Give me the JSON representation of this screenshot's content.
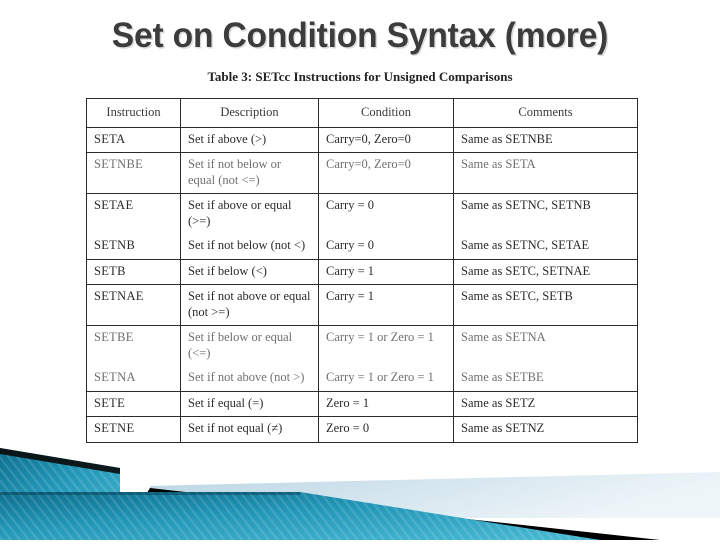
{
  "slide": {
    "title": "Set on Condition Syntax (more)",
    "caption": "Table 3: SETcc Instructions for Unsigned Comparisons"
  },
  "colors": {
    "title_text": "#3c3c3c",
    "title_shadow": "#bebebe",
    "table_border": "#2b2b2b",
    "ribbon_teal_dark": "#0f6d8c",
    "ribbon_teal_light": "#3fb2cf",
    "ribbon_pale_blue": "#c8dde8",
    "ribbon_black": "#000000",
    "page_background": "#ffffff"
  },
  "table": {
    "headers": [
      "Instruction",
      "Description",
      "Condition",
      "Comments"
    ],
    "rows": [
      {
        "instruction": "SETA",
        "description": "Set if above (>)",
        "condition": "Carry=0, Zero=0",
        "comments": "Same as SETNBE",
        "pair": "none",
        "faint": false
      },
      {
        "instruction": "SETNBE",
        "description": "Set if not below or equal (not <=)",
        "condition": "Carry=0, Zero=0",
        "comments": "Same as SETA",
        "pair": "none",
        "faint": true
      },
      {
        "instruction": "SETAE",
        "description": "Set if above or equal (>=)",
        "condition": "Carry = 0",
        "comments": "Same as SETNC, SETNB",
        "pair": "top",
        "faint": false
      },
      {
        "instruction": "SETNB",
        "description": "Set if not below (not <)",
        "condition": "Carry = 0",
        "comments": "Same as SETNC, SETAE",
        "pair": "bottom",
        "faint": false
      },
      {
        "instruction": "SETB",
        "description": "Set if below (<)",
        "condition": "Carry = 1",
        "comments": "Same as SETC, SETNAE",
        "pair": "none",
        "faint": false
      },
      {
        "instruction": "SETNAE",
        "description": "Set if not above or equal (not >=)",
        "condition": "Carry = 1",
        "comments": "Same as SETC, SETB",
        "pair": "none",
        "faint": false
      },
      {
        "instruction": "SETBE",
        "description": "Set if below or equal (<=)",
        "condition": "Carry = 1 or Zero = 1",
        "comments": "Same as SETNA",
        "pair": "top",
        "faint": true
      },
      {
        "instruction": "SETNA",
        "description": "Set if not above (not >)",
        "condition": "Carry = 1 or Zero = 1",
        "comments": "Same as SETBE",
        "pair": "bottom",
        "faint": true
      },
      {
        "instruction": "SETE",
        "description": "Set if equal (=)",
        "condition": "Zero = 1",
        "comments": "Same as SETZ",
        "pair": "none",
        "faint": false
      },
      {
        "instruction": "SETNE",
        "description": "Set if not equal (≠)",
        "condition": "Zero = 0",
        "comments": "Same as SETNZ",
        "pair": "none",
        "faint": false
      }
    ]
  }
}
